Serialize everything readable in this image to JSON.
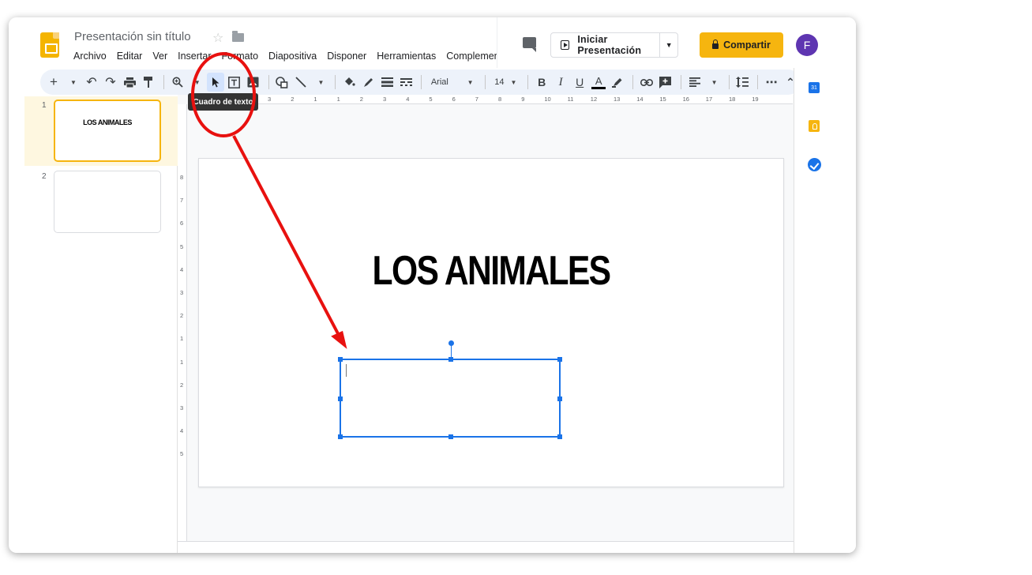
{
  "header": {
    "doc_title": "Presentación sin título",
    "menu": [
      "Archivo",
      "Editar",
      "Ver",
      "Insertar",
      "Formato",
      "Diapositiva",
      "Disponer",
      "Herramientas",
      "Complemen"
    ],
    "present_label": "Iniciar Presentación",
    "share_label": "Compartir",
    "avatar_letter": "F",
    "accent_color": "#f6b50f",
    "avatar_color": "#5e35b1"
  },
  "toolbar": {
    "font": "Arial",
    "font_size": "14",
    "tooltip": "Cuadro de texto",
    "bold": "B",
    "italic": "I",
    "underline": "U",
    "text_color": "A",
    "more": "⋯",
    "collapse": "⌃"
  },
  "filmstrip": {
    "slides": [
      {
        "num": "1",
        "title": "LOS ANIMALES"
      },
      {
        "num": "2",
        "title": ""
      }
    ]
  },
  "slide": {
    "title": "LOS ANIMALES"
  },
  "ruler": {
    "horizontal": [
      "3",
      "2",
      "1",
      "1",
      "2",
      "3",
      "4",
      "5",
      "6",
      "7",
      "8",
      "9",
      "10",
      "11",
      "12",
      "13",
      "14",
      "15",
      "16",
      "17",
      "18",
      "19"
    ],
    "vertical": [
      "8",
      "7",
      "6",
      "5",
      "4",
      "3",
      "2",
      "1",
      "1",
      "2",
      "3",
      "4",
      "5"
    ]
  },
  "side_panel": {
    "calendar_day": "31",
    "icons": [
      "calendar-icon",
      "keep-icon",
      "tasks-icon"
    ]
  },
  "annotation_color": "#e8110f"
}
